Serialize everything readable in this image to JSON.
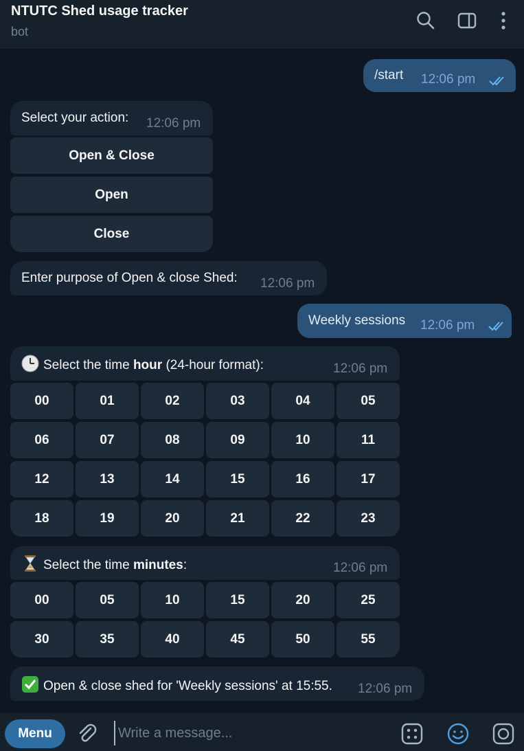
{
  "header": {
    "title": "NTUTC Shed usage tracker",
    "subtitle": "bot",
    "icons": [
      "search-icon",
      "sidebar-toggle-icon",
      "more-vertical-icon"
    ]
  },
  "messages": {
    "start": {
      "text": "/start",
      "time": "12:06 pm"
    },
    "select_action": {
      "text": "Select your action:",
      "time": "12:06 pm",
      "buttons": [
        "Open & Close",
        "Open",
        "Close"
      ]
    },
    "purpose_prompt": {
      "text": "Enter purpose of Open & close Shed:",
      "time": "12:06 pm"
    },
    "purpose_reply": {
      "text": "Weekly sessions",
      "time": "12:06 pm"
    },
    "hour_prompt": {
      "icon": "clock-icon",
      "text_before": "Select the time ",
      "text_bold": "hour",
      "text_after": " (24-hour format):",
      "time": "12:06 pm",
      "buttons": [
        "00",
        "01",
        "02",
        "03",
        "04",
        "05",
        "06",
        "07",
        "08",
        "09",
        "10",
        "11",
        "12",
        "13",
        "14",
        "15",
        "16",
        "17",
        "18",
        "19",
        "20",
        "21",
        "22",
        "23"
      ]
    },
    "minute_prompt": {
      "icon": "hourglass-icon",
      "text_before": "Select the time ",
      "text_bold": "minutes",
      "text_after": ":",
      "time": "12:06 pm",
      "buttons": [
        "00",
        "05",
        "10",
        "15",
        "20",
        "25",
        "30",
        "35",
        "40",
        "45",
        "50",
        "55"
      ]
    },
    "confirmation": {
      "icon": "check-mark-icon",
      "text": "Open & close shed for 'Weekly sessions' at 15:55.",
      "time": "12:06 pm"
    }
  },
  "composer": {
    "menu_label": "Menu",
    "placeholder": "Write a message...",
    "icons": [
      "attach-icon",
      "bot-commands-icon",
      "emoji-icon",
      "camera-icon"
    ]
  },
  "colors": {
    "background": "#0e1621",
    "header": "#17212b",
    "incoming_bubble": "#182533",
    "outgoing_bubble": "#2b5278",
    "keyboard_button": "#1e2c3a",
    "accent": "#2f6ea5"
  }
}
